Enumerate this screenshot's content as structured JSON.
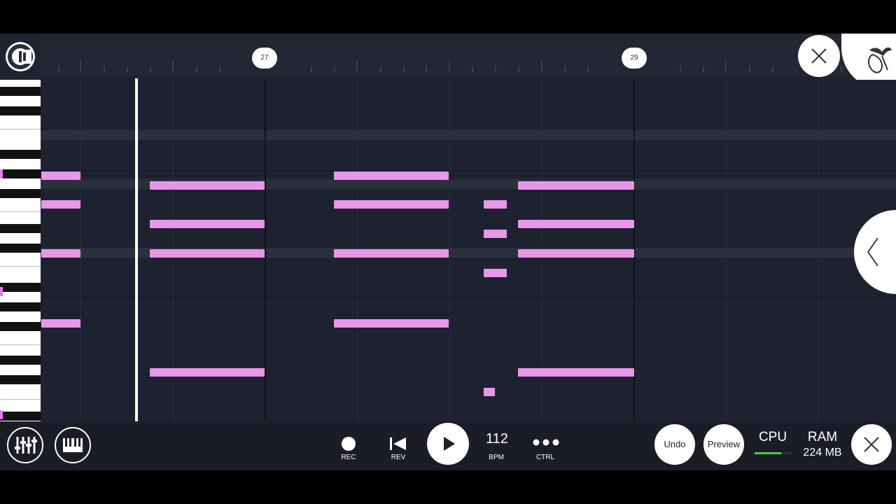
{
  "timeline": {
    "markers": [
      {
        "label": "27"
      },
      {
        "label": "29"
      }
    ]
  },
  "transport": {
    "rec_label": "REC",
    "rev_label": "REV",
    "tempo_value": "112",
    "tempo_label": "BPM",
    "ctrl_label": "CTRL"
  },
  "actions": {
    "undo_label": "Undo",
    "preview_label": "Preview"
  },
  "status": {
    "cpu_label": "CPU",
    "ram_label": "RAM",
    "ram_value": "224 MB"
  },
  "colors": {
    "note": "#e796e8",
    "grid_bg": "#1d2130",
    "cpu_meter": "#3fd43f"
  }
}
